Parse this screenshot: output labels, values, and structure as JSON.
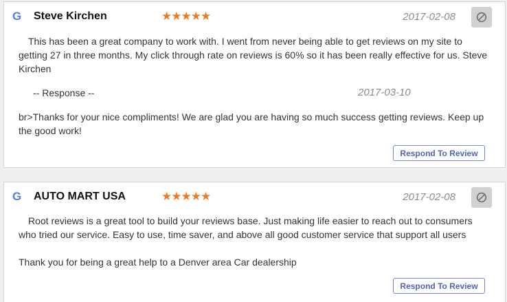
{
  "icons": {
    "source": "google-icon",
    "block": "block-icon",
    "stars": "star-icon"
  },
  "colors": {
    "star": "#ef7a22",
    "google_blue": "#4f7fe0",
    "button_text": "#4f67b3"
  },
  "reviews": [
    {
      "source_glyph": "G",
      "reviewer": "Steve Kirchen",
      "rating": 5,
      "stars_text": "★★★★★",
      "date": "2017-02-08",
      "body": "This has been a great company to work with. I went from never being able to get reviews on my site to getting 27 in three months. My click through rate on reviews is 60% so it has been really effective for us. Steve Kirchen",
      "response_label": "-- Response --",
      "response_date": "2017-03-10",
      "response_text": "br>Thanks for your nice compliments! We are glad you are having so much success getting reviews. Keep up the good work!",
      "respond_button": "Respond To Review"
    },
    {
      "source_glyph": "G",
      "reviewer": "AUTO MART USA",
      "rating": 5,
      "stars_text": "★★★★★",
      "date": "2017-02-08",
      "body": "Root reviews is a great tool to build your reviews base. Just making life easier to reach out to consumers who tried our service. Easy to use, time saver, and above all good customer service that support all users",
      "body_extra": "Thank you for being a great help to a Denver area Car dealership",
      "respond_button": "Respond To Review"
    }
  ]
}
